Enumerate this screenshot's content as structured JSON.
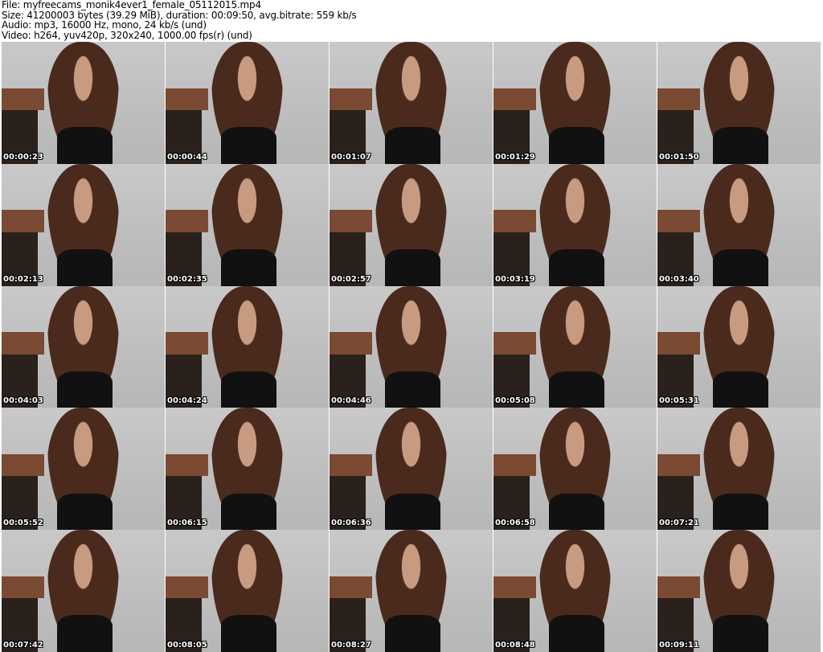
{
  "header": {
    "file": "File: myfreecams_monik4ever1_female_05112015.mp4",
    "size": "Size: 41200003 bytes (39.29 MiB), duration: 00:09:50, avg.bitrate: 559 kb/s",
    "audio": "Audio: mp3, 16000 Hz, mono, 24 kb/s (und)",
    "video": "Video: h264, yuv420p, 320x240, 1000.00 fps(r) (und)"
  },
  "timestamps": [
    "00:00:23",
    "00:00:44",
    "00:01:07",
    "00:01:29",
    "00:01:50",
    "00:02:13",
    "00:02:35",
    "00:02:57",
    "00:03:19",
    "00:03:40",
    "00:04:03",
    "00:04:24",
    "00:04:46",
    "00:05:08",
    "00:05:31",
    "00:05:52",
    "00:06:15",
    "00:06:36",
    "00:06:58",
    "00:07:21",
    "00:07:42",
    "00:08:05",
    "00:08:27",
    "00:08:48",
    "00:09:11"
  ]
}
